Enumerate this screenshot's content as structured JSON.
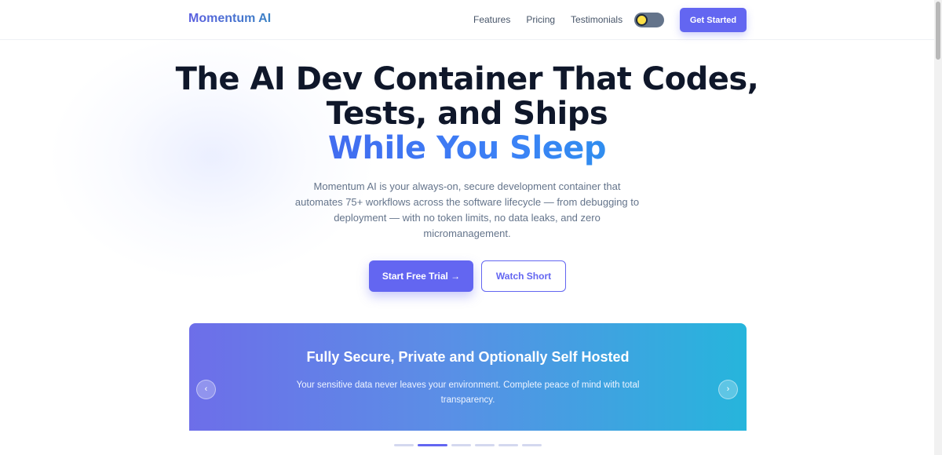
{
  "nav": {
    "brand": "Momentum AI",
    "links": [
      "Features",
      "Pricing",
      "Testimonials"
    ],
    "theme_toggle_icon": "sun-icon",
    "cta_label": "Get Started"
  },
  "hero": {
    "title_line1": "The AI Dev Container That Codes,",
    "title_line2": "Tests, and Ships",
    "title_accent": "While You Sleep",
    "subtitle": "Momentum AI is your always-on, secure development container that automates 75+ workflows across the software lifecycle — from debugging to deployment — with no token limits, no data leaks, and zero micromanagement.",
    "primary_button": "Start Free Trial →",
    "secondary_button": "Watch Short"
  },
  "carousel": {
    "title": "Fully Secure, Private and Optionally Self Hosted",
    "text": "Your sensitive data never leaves your environment. Complete peace of mind with total transparency.",
    "prev_glyph": "‹",
    "next_glyph": "›",
    "slide_count": 6,
    "active_index": 1
  },
  "colors": {
    "accent": "#6366f1",
    "gradient_start": "#6d6ee9",
    "gradient_end": "#26b5dc",
    "heading": "#0f172a",
    "muted_text": "#64748b"
  }
}
